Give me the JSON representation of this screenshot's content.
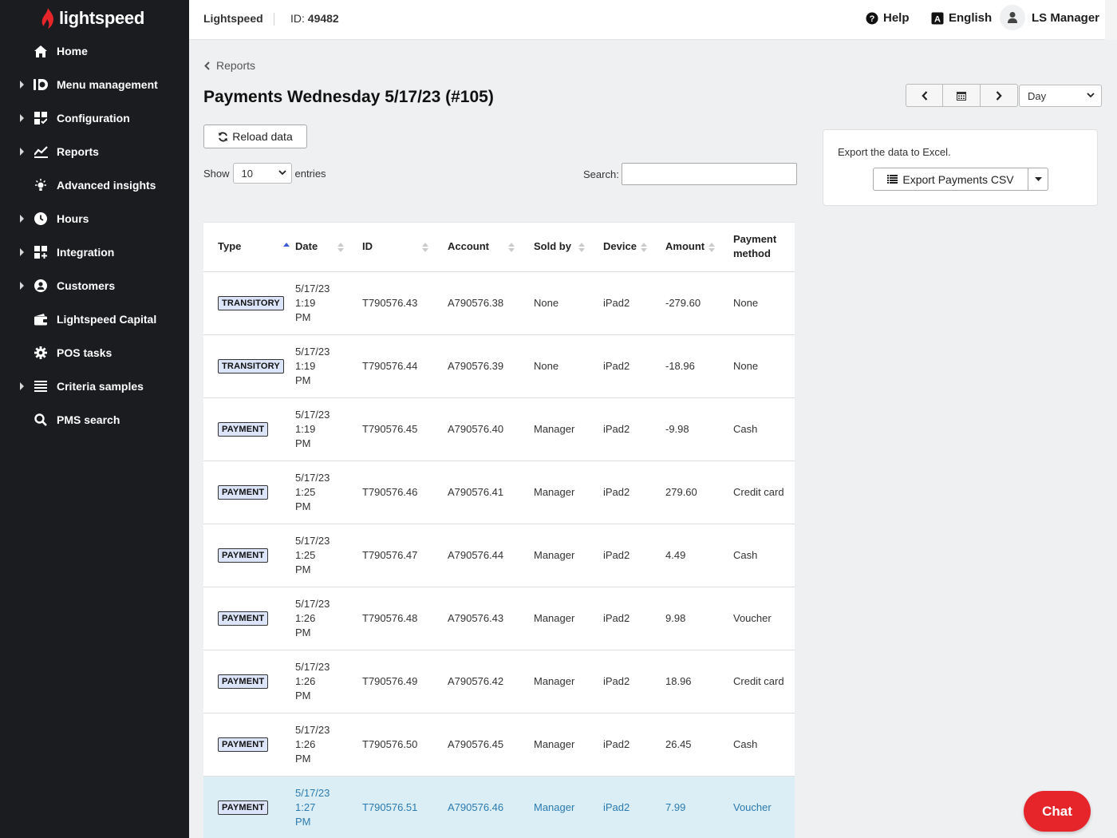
{
  "brand": {
    "logo_text": "lightspeed"
  },
  "sidebar": {
    "items": [
      {
        "label": "Home",
        "icon": "home-icon",
        "expandable": false
      },
      {
        "label": "Menu management",
        "icon": "menu-management-icon",
        "expandable": true
      },
      {
        "label": "Configuration",
        "icon": "configuration-icon",
        "expandable": true
      },
      {
        "label": "Reports",
        "icon": "reports-icon",
        "expandable": true
      },
      {
        "label": "Advanced insights",
        "icon": "lightbulb-icon",
        "expandable": false
      },
      {
        "label": "Hours",
        "icon": "clock-icon",
        "expandable": true
      },
      {
        "label": "Integration",
        "icon": "integration-icon",
        "expandable": true
      },
      {
        "label": "Customers",
        "icon": "customer-icon",
        "expandable": true
      },
      {
        "label": "Lightspeed Capital",
        "icon": "wallet-icon",
        "expandable": false
      },
      {
        "label": "POS tasks",
        "icon": "gear-icon",
        "expandable": false
      },
      {
        "label": "Criteria samples",
        "icon": "list-icon",
        "expandable": true
      },
      {
        "label": "PMS search",
        "icon": "search-icon",
        "expandable": false
      }
    ]
  },
  "topbar": {
    "brand": "Lightspeed",
    "id_label": "ID:",
    "id_value": "49482",
    "help": "Help",
    "language": "English",
    "user": "LS Manager"
  },
  "breadcrumb": {
    "label": "Reports"
  },
  "page": {
    "title": "Payments Wednesday 5/17/23 (#105)"
  },
  "period": {
    "selected": "Day"
  },
  "controls": {
    "reload": "Reload data",
    "show": "Show",
    "entries_value": "10",
    "entries": "entries",
    "search_label": "Search:",
    "search_value": ""
  },
  "export": {
    "text": "Export the data to Excel.",
    "button": "Export Payments CSV"
  },
  "table": {
    "columns": [
      "Type",
      "Date",
      "ID",
      "Account",
      "Sold by",
      "Device",
      "Amount",
      "Payment method"
    ],
    "rows": [
      {
        "type": "TRANSITORY",
        "date": "5/17/23\n1:19\nPM",
        "id": "T790576.43",
        "account": "A790576.38",
        "sold_by": "None",
        "device": "iPad2",
        "amount": "-279.60",
        "method": "None"
      },
      {
        "type": "TRANSITORY",
        "date": "5/17/23\n1:19\nPM",
        "id": "T790576.44",
        "account": "A790576.39",
        "sold_by": "None",
        "device": "iPad2",
        "amount": "-18.96",
        "method": "None"
      },
      {
        "type": "PAYMENT",
        "date": "5/17/23\n1:19\nPM",
        "id": "T790576.45",
        "account": "A790576.40",
        "sold_by": "Manager",
        "device": "iPad2",
        "amount": "-9.98",
        "method": "Cash"
      },
      {
        "type": "PAYMENT",
        "date": "5/17/23\n1:25\nPM",
        "id": "T790576.46",
        "account": "A790576.41",
        "sold_by": "Manager",
        "device": "iPad2",
        "amount": "279.60",
        "method": "Credit card"
      },
      {
        "type": "PAYMENT",
        "date": "5/17/23\n1:25\nPM",
        "id": "T790576.47",
        "account": "A790576.44",
        "sold_by": "Manager",
        "device": "iPad2",
        "amount": "4.49",
        "method": "Cash"
      },
      {
        "type": "PAYMENT",
        "date": "5/17/23\n1:26\nPM",
        "id": "T790576.48",
        "account": "A790576.43",
        "sold_by": "Manager",
        "device": "iPad2",
        "amount": "9.98",
        "method": "Voucher"
      },
      {
        "type": "PAYMENT",
        "date": "5/17/23\n1:26\nPM",
        "id": "T790576.49",
        "account": "A790576.42",
        "sold_by": "Manager",
        "device": "iPad2",
        "amount": "18.96",
        "method": "Credit card"
      },
      {
        "type": "PAYMENT",
        "date": "5/17/23\n1:26\nPM",
        "id": "T790576.50",
        "account": "A790576.45",
        "sold_by": "Manager",
        "device": "iPad2",
        "amount": "26.45",
        "method": "Cash"
      },
      {
        "type": "PAYMENT",
        "date": "5/17/23\n1:27\nPM",
        "id": "T790576.51",
        "account": "A790576.46",
        "sold_by": "Manager",
        "device": "iPad2",
        "amount": "7.99",
        "method": "Voucher",
        "selected": true
      }
    ]
  },
  "chat": {
    "label": "Chat"
  },
  "colors": {
    "sidebar_bg": "#1a1c20",
    "accent_red": "#e5252a",
    "badge_bg": "#dbe4f8",
    "selected_row": "#dceef5",
    "selected_text": "#2a7ab0"
  }
}
